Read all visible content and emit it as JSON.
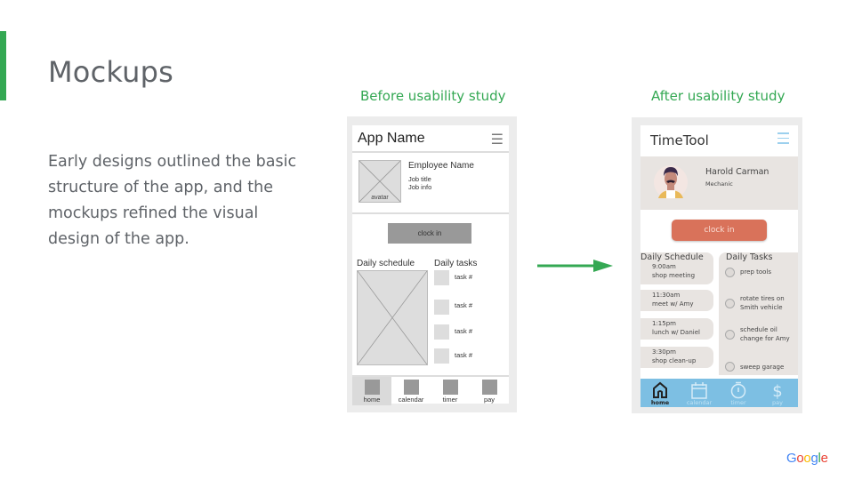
{
  "slide": {
    "title": "Mockups",
    "body": "Early designs outlined the basic structure of the app, and the mockups refined the visual design of the app.",
    "accent_color": "#34a853"
  },
  "before": {
    "caption": "Before usability study",
    "app_name": "App Name",
    "menu_icon": "hamburger-menu-icon",
    "avatar_label": "avatar",
    "employee_name": "Employee Name",
    "job_title": "Job title",
    "job_info": "Job info",
    "clock_in": "clock in",
    "schedule_title": "Daily schedule",
    "tasks_title": "Daily tasks",
    "tasks": [
      "task #",
      "task #",
      "task #",
      "task #"
    ],
    "nav": [
      "home",
      "calendar",
      "timer",
      "pay"
    ],
    "active_nav": "home"
  },
  "after": {
    "caption": "After usability study",
    "app_name": "TimeTool",
    "menu_icon": "hamburger-menu-icon",
    "employee_name": "Harold Carman",
    "role": "Mechanic",
    "clock_in": "clock in",
    "clock_color": "#d9725a",
    "schedule_title": "Daily Schedule",
    "schedule": [
      {
        "time": "9:00am",
        "event": "shop meeting"
      },
      {
        "time": "11:30am",
        "event": "meet w/ Amy"
      },
      {
        "time": "1:15pm",
        "event": "lunch w/ Daniel"
      },
      {
        "time": "3:30pm",
        "event": "shop clean-up"
      }
    ],
    "tasks_title": "Daily Tasks",
    "tasks": [
      {
        "line1": "prep tools",
        "line2": ""
      },
      {
        "line1": "rotate tires on",
        "line2": "Smith vehicle"
      },
      {
        "line1": "schedule oil",
        "line2": "change for Amy"
      },
      {
        "line1": "sweep garage",
        "line2": ""
      }
    ],
    "nav": [
      {
        "label": "home",
        "icon": "home-icon"
      },
      {
        "label": "calendar",
        "icon": "calendar-icon"
      },
      {
        "label": "timer",
        "icon": "timer-icon"
      },
      {
        "label": "pay",
        "icon": "dollar-icon"
      }
    ],
    "active_nav": "home",
    "nav_color": "#7dbfe3"
  },
  "logo": {
    "letters": [
      "G",
      "o",
      "o",
      "g",
      "l",
      "e"
    ],
    "colors": [
      "#4285f4",
      "#ea4335",
      "#fbbc05",
      "#4285f4",
      "#34a853",
      "#ea4335"
    ]
  }
}
